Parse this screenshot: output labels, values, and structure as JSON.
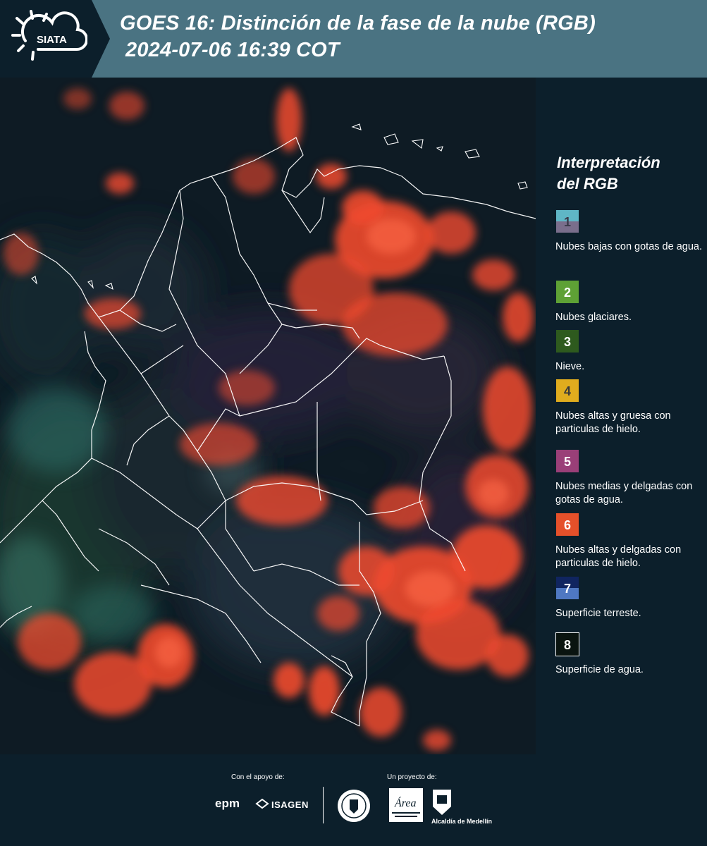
{
  "header": {
    "logo_text": "SIATA",
    "title_line1": "GOES 16: Distinción de la fase de la nube (RGB)",
    "title_line2": "2024-07-06 16:39 COT"
  },
  "legend": {
    "title_line1": "Interpretación",
    "title_line2": "del RGB",
    "items": [
      {
        "num": "1",
        "label": "Nubes bajas con gotas de agua.",
        "color_top": "#5fb6c6",
        "color_bottom": "#7a6e8c",
        "num_color": "#3a3a4a"
      },
      {
        "num": "2",
        "label": "Nubes glaciares.",
        "color_top": "#5ea135",
        "color_bottom": "#5ea135",
        "num_color": "#ffffff"
      },
      {
        "num": "3",
        "label": "Nieve.",
        "color_top": "#2e5a1e",
        "color_bottom": "#2e5a1e",
        "num_color": "#ffffff"
      },
      {
        "num": "4",
        "label": "Nubes altas y gruesa con particulas de hielo.",
        "color_top": "#e0ac1e",
        "color_bottom": "#e0ac1e",
        "num_color": "#3a3a3a"
      },
      {
        "num": "5",
        "label": "Nubes medias y delgadas con gotas de agua.",
        "color_top": "#9a3f78",
        "color_bottom": "#9a3f78",
        "num_color": "#ffffff"
      },
      {
        "num": "6",
        "label": "Nubes altas y delgadas con particulas de hielo.",
        "color_top": "#e5502a",
        "color_bottom": "#e5502a",
        "num_color": "#ffffff"
      },
      {
        "num": "7",
        "label": "Superficie terreste.",
        "color_top": "#102560",
        "color_bottom": "#4f78c2",
        "num_color": "#ffffff"
      },
      {
        "num": "8",
        "label": "Superficie de agua.",
        "color_top": "#0a1410",
        "color_bottom": "#0a1410",
        "num_color": "#ffffff"
      }
    ]
  },
  "footer": {
    "support_label": "Con el apoyo de:",
    "project_label": "Un proyecto de:",
    "epm": "epm",
    "isagen": "ISAGEN",
    "alcaldia": "Alcaldía de Medellín",
    "area_text": "Área"
  },
  "colors": {
    "header_bg": "#4a7382",
    "page_bg": "#0c1f2b",
    "cloud_red": "#f24a2e"
  }
}
